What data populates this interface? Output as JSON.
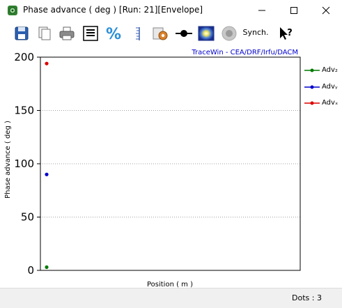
{
  "window": {
    "title": "Phase advance ( deg ) [Run: 21][Envelope]"
  },
  "toolbar": {
    "synch_label": "Synch."
  },
  "plot": {
    "watermark": "TraceWin - CEA/DRF/Irfu/DACM"
  },
  "status": {
    "dots_text": "Dots : 3"
  },
  "colors": {
    "adv_z": "#007a00",
    "adv_y": "#0000cc",
    "adv_x": "#dd0000",
    "grid": "#a0a0a0",
    "watermark": "#0000cc"
  },
  "chart_data": {
    "type": "scatter",
    "xlabel": "Position ( m )",
    "ylabel": "Phase advance ( deg )",
    "ylim": [
      0,
      200
    ],
    "yticks": [
      "0",
      "50",
      "100",
      "150",
      "200"
    ],
    "xticks": [],
    "grid": "horizontal dotted",
    "legend_position": "right",
    "series": [
      {
        "name": "Adv₂",
        "color": "#007a00",
        "x": [
          0
        ],
        "y": [
          3
        ]
      },
      {
        "name": "Advᵧ",
        "color": "#0000cc",
        "x": [
          0
        ],
        "y": [
          90
        ]
      },
      {
        "name": "Advₓ",
        "color": "#dd0000",
        "x": [
          0
        ],
        "y": [
          194
        ]
      }
    ]
  }
}
